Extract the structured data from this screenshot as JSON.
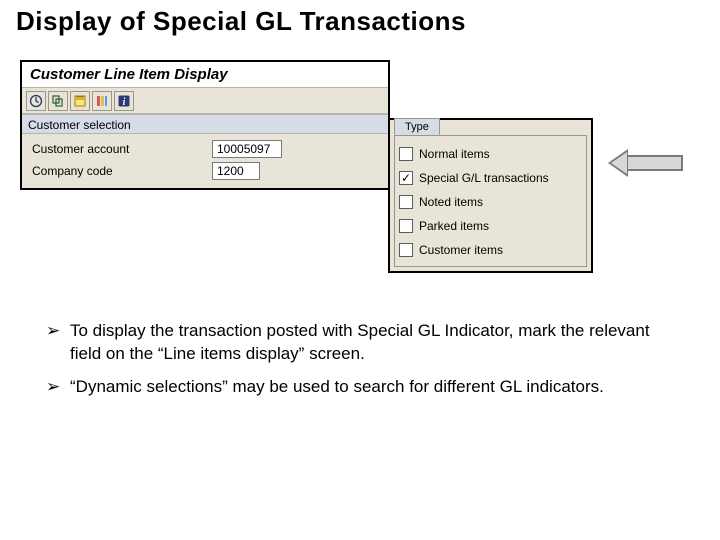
{
  "title": "Display of Special GL Transactions",
  "window_title": "Customer Line Item Display",
  "icons": {
    "clock": "clock-icon",
    "choose": "choose-icon",
    "save": "save-icon",
    "columns": "columns-icon",
    "info": "info-icon"
  },
  "selection": {
    "section_label": "Customer selection",
    "account_label": "Customer account",
    "account_value": "10005097",
    "cc_label": "Company code",
    "cc_value": "1200"
  },
  "type": {
    "tab_label": "Type",
    "items": [
      {
        "label": "Normal items",
        "checked": false
      },
      {
        "label": "Special G/L transactions",
        "checked": true
      },
      {
        "label": "Noted items",
        "checked": false
      },
      {
        "label": "Parked items",
        "checked": false
      },
      {
        "label": "Customer items",
        "checked": false
      }
    ]
  },
  "bullets": [
    "To display the transaction posted with Special GL Indicator, mark the relevant field on the “Line items display” screen.",
    "“Dynamic selections” may be used to search for different GL indicators."
  ]
}
